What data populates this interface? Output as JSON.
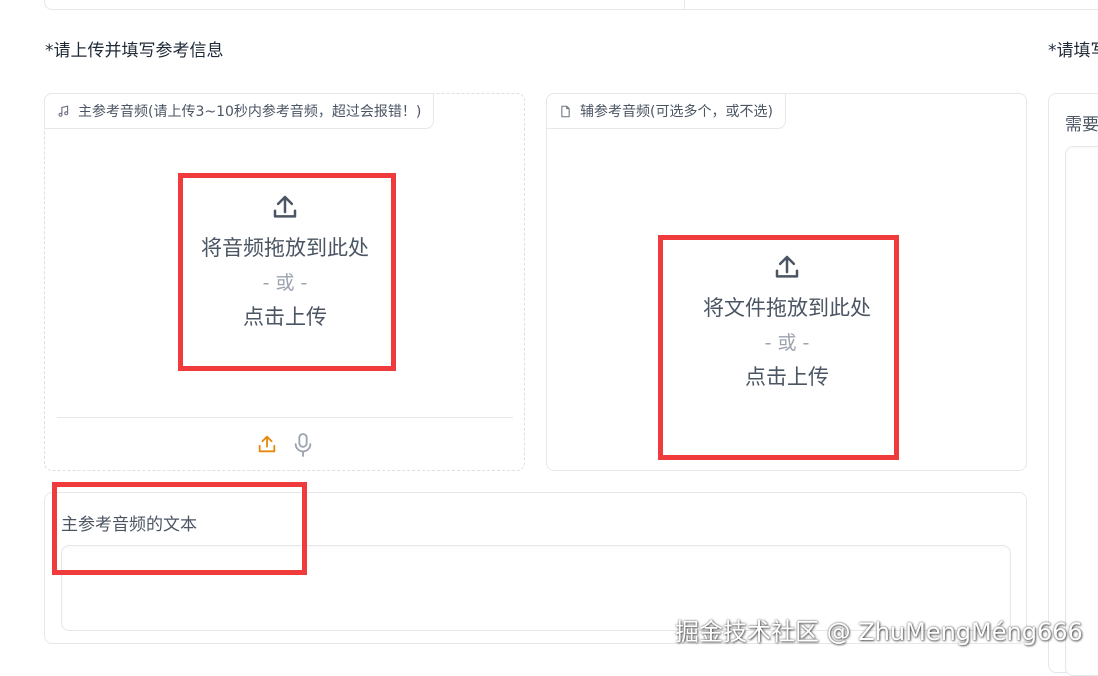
{
  "left_section": {
    "title": "*请上传并填写参考信息"
  },
  "right_section": {
    "title_partial": "*请填写",
    "panel_label_partial": "需要"
  },
  "main_audio": {
    "tag_label": "主参考音频(请上传3~10秒内参考音频，超过会报错！)",
    "drop_text": "将音频拖放到此处",
    "or_text": "- 或 -",
    "click_text": "点击上传",
    "upload_icon": "upload-icon",
    "mic_icon": "microphone-icon",
    "accent_color": "#e8880c"
  },
  "aux_audio": {
    "tag_label": "辅参考音频(可选多个，或不选)",
    "drop_text": "将文件拖放到此处",
    "or_text": "- 或 -",
    "click_text": "点击上传"
  },
  "ref_text": {
    "label": "主参考音频的文本",
    "value": ""
  },
  "highlight_color": "#ef3b3b",
  "watermark": "掘金技术社区 @ ZhuMengMéng666"
}
